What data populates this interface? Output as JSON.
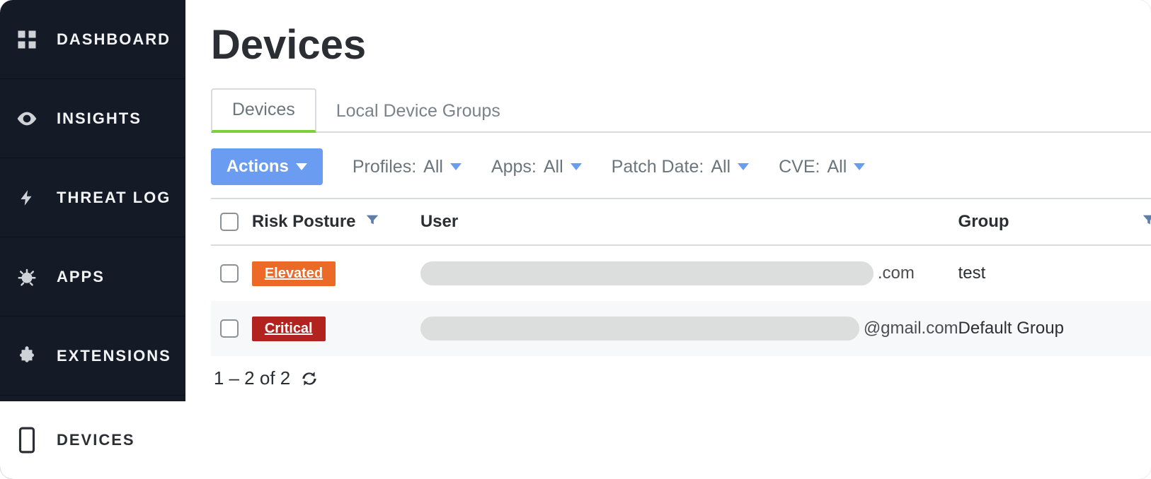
{
  "sidebar": {
    "items": [
      {
        "id": "dashboard",
        "label": "DASHBOARD",
        "icon": "grid"
      },
      {
        "id": "insights",
        "label": "INSIGHTS",
        "icon": "eye"
      },
      {
        "id": "threatlog",
        "label": "THREAT LOG",
        "icon": "bolt"
      },
      {
        "id": "apps",
        "label": "APPS",
        "icon": "bug"
      },
      {
        "id": "extensions",
        "label": "EXTENSIONS",
        "icon": "puzzle"
      }
    ],
    "bottom": {
      "id": "devices",
      "label": "DEVICES",
      "icon": "device"
    }
  },
  "page": {
    "title": "Devices"
  },
  "tabs": [
    {
      "id": "devices",
      "label": "Devices",
      "active": true
    },
    {
      "id": "localgroups",
      "label": "Local Device Groups",
      "active": false
    }
  ],
  "toolbar": {
    "actions_label": "Actions",
    "filters": {
      "profiles": {
        "label": "Profiles:",
        "value": "All"
      },
      "apps": {
        "label": "Apps:",
        "value": "All"
      },
      "patch": {
        "label": "Patch Date:",
        "value": "All"
      },
      "cve": {
        "label": "CVE:",
        "value": "All"
      }
    }
  },
  "table": {
    "columns": {
      "risk": "Risk Posture",
      "user": "User",
      "group": "Group"
    },
    "rows": [
      {
        "risk": {
          "label": "Elevated",
          "level": "elevated"
        },
        "user_suffix": ".com",
        "group": "test"
      },
      {
        "risk": {
          "label": "Critical",
          "level": "critical"
        },
        "user_suffix": "@gmail.com",
        "group": "Default Group"
      }
    ]
  },
  "pager": {
    "text": "1 – 2 of 2"
  },
  "colors": {
    "sidebar_bg": "#141a26",
    "accent_green": "#7bd13a",
    "actions_blue": "#6a9cf2",
    "elevated": "#eb6a28",
    "critical": "#b2221e"
  }
}
